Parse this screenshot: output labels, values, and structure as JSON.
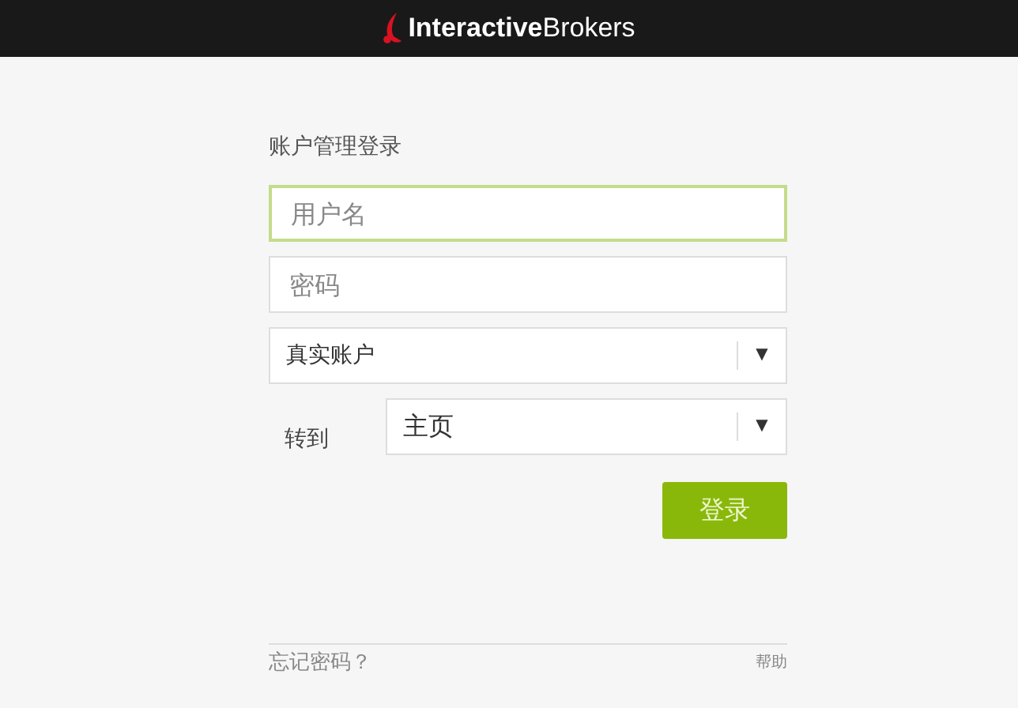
{
  "header": {
    "logo_text": "**Interactive**Brokers"
  },
  "login": {
    "title": "账户管理登录",
    "username": {
      "placeholder": "用户名",
      "focused": true
    },
    "password": {
      "placeholder": "密码",
      "focused": false
    },
    "account_type": {
      "value": "真实账户",
      "arrow": "▼"
    },
    "goto": {
      "label": "转到",
      "value": "主页",
      "arrow": "▼"
    },
    "submit": "登录",
    "forgot_link": "忘记密码？",
    "help_link": "帮助"
  }
}
